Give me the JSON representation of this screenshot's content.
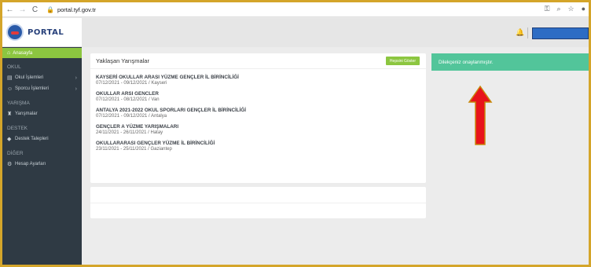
{
  "browser": {
    "url": "portal.tyf.gov.tr",
    "back_icon": "arrow-left-icon",
    "forward_icon": "arrow-right-icon",
    "reload_icon": "reload-icon"
  },
  "app": {
    "logo_text": "PORTAL"
  },
  "sidebar": {
    "active_item": "Anasayfa",
    "sections": {
      "okul": "OKUL",
      "yarisma": "YARIŞMA",
      "destek": "DESTEK",
      "diger": "DİĞER"
    },
    "items": {
      "okul_islemleri": "Okul İşlemleri",
      "sporcu_islemleri": "Sporcu İşlemleri",
      "yarismalar": "Yarışmalar",
      "destek_talepleri": "Destek Talepleri",
      "hesap_ayarlari": "Hesap Ayarları"
    }
  },
  "upcoming": {
    "title": "Yaklaşan Yarışmalar",
    "show_all_label": "Hepsini Göster",
    "competitions": [
      {
        "name": "KAYSERİ OKULLAR ARASI YÜZME GENÇLER İL BİRİNCİLİĞİ",
        "details": "07/12/2021 - 09/12/2021 / Kayseri"
      },
      {
        "name": "OKULLAR ARSI GENCLER",
        "details": "07/12/2021 - 08/12/2021 / Van"
      },
      {
        "name": "ANTALYA 2021-2022 OKUL SPORLARI GENÇLER İL BİRİNCİLİĞİ",
        "details": "07/12/2021 - 09/12/2021 / Antalya"
      },
      {
        "name": "GENÇLER A YÜZME YARIŞMALARI",
        "details": "24/11/2021 - 26/11/2021 / Hatay"
      },
      {
        "name": "OKULLARARASI GENÇLER YÜZME İL BİRİNCİLİĞİ",
        "details": "23/11/2021 - 25/11/2021 / Gaziantep"
      }
    ]
  },
  "alert": {
    "message": "Dilekçeniz onaylanmıştır."
  },
  "colors": {
    "accent_green": "#8cc640",
    "alert_green": "#52c59a",
    "sidebar_bg": "#2f3a44",
    "annotation_arrow": "#e8131b"
  }
}
